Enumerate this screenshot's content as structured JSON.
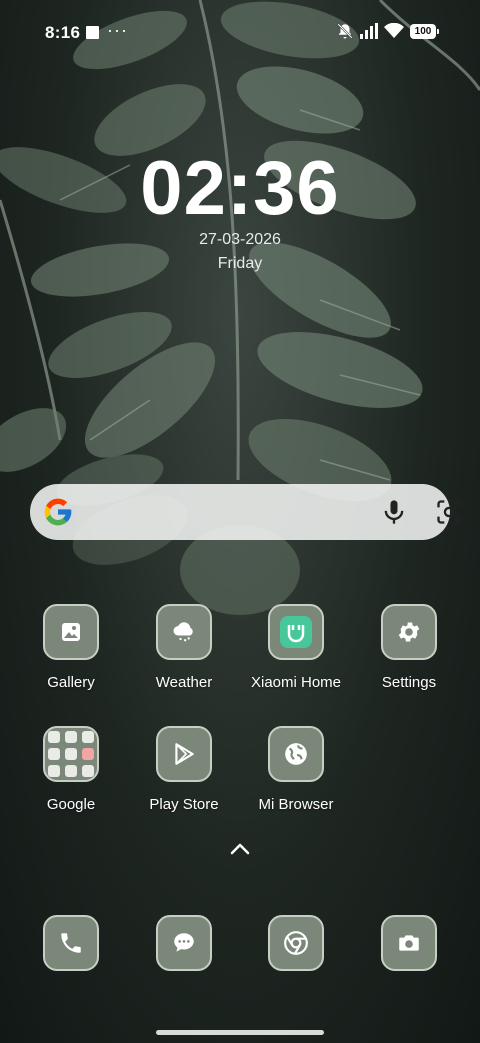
{
  "status_bar": {
    "time": "8:16",
    "battery": "100"
  },
  "lockclock": {
    "time": "02:36",
    "date": "27-03-2026",
    "day": "Friday"
  },
  "search": {
    "icons": [
      "google-logo",
      "mic-icon",
      "lens-icon"
    ]
  },
  "apps": {
    "row1": [
      {
        "label": "Gallery",
        "icon": "gallery-icon"
      },
      {
        "label": "Weather",
        "icon": "weather-icon"
      },
      {
        "label": "Xiaomi Home",
        "icon": "xiaomi-home-icon"
      },
      {
        "label": "Settings",
        "icon": "gear-icon"
      }
    ],
    "row2": [
      {
        "label": "Google",
        "icon": "folder-icon"
      },
      {
        "label": "Play Store",
        "icon": "play-store-icon"
      },
      {
        "label": "Mi Browser",
        "icon": "globe-icon"
      }
    ]
  },
  "dock": [
    {
      "icon": "phone-icon"
    },
    {
      "icon": "messages-icon"
    },
    {
      "icon": "chrome-icon"
    },
    {
      "icon": "camera-icon"
    }
  ],
  "colors": {
    "icon_bg": "#7a8779",
    "icon_border": "#c7cfc5",
    "xiaomi_accent": "#48c79a",
    "search_bg": "#f2f4f2"
  }
}
